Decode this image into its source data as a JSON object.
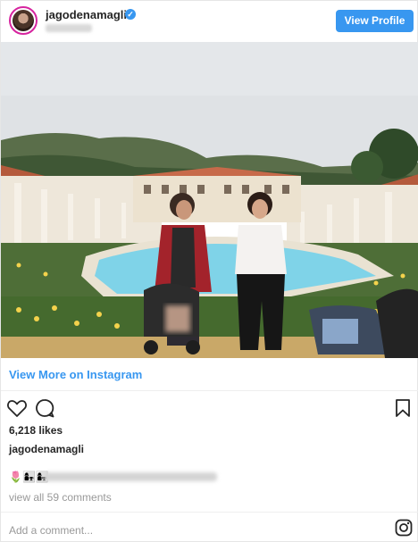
{
  "header": {
    "username": "jagodenamagli",
    "verified_icon": "verified-badge-icon",
    "view_profile_label": "View Profile"
  },
  "photo": {
    "description_icon": "post-photo"
  },
  "links": {
    "view_more": "View More on Instagram"
  },
  "actions": {
    "like_icon": "heart-icon",
    "comment_icon": "comment-icon",
    "save_icon": "bookmark-icon"
  },
  "post": {
    "likes": "6,218 likes",
    "caption_user": "jagodenamagli",
    "caption_emojis": "🌷👩‍👧👩‍👧",
    "view_comments": "view all 59 comments"
  },
  "footer": {
    "add_comment_placeholder": "Add a comment...",
    "logo_icon": "instagram-icon"
  },
  "colors": {
    "accent": "#3897f0",
    "text": "#262626",
    "muted": "#999999",
    "border": "#efefef"
  }
}
